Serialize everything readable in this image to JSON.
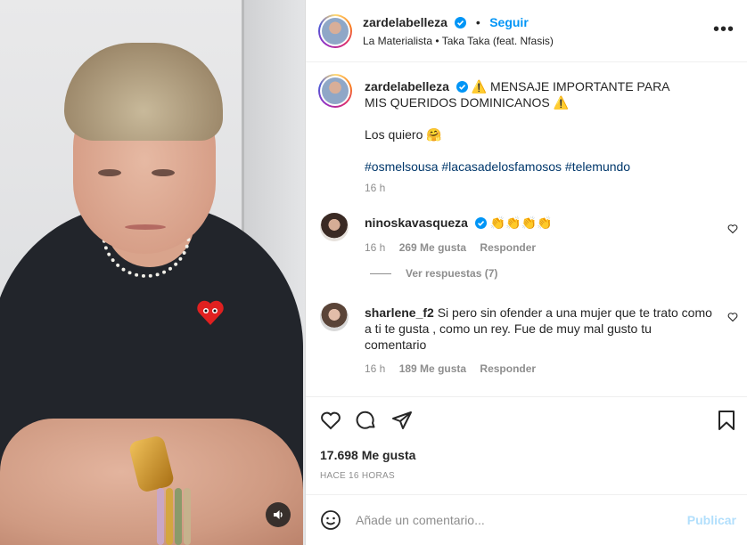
{
  "header": {
    "username": "zardelabelleza",
    "separator": "•",
    "follow_label": "Seguir",
    "song": "La Materialista • Taka Taka (feat. Nfasis)",
    "more_label": "•••"
  },
  "caption": {
    "username": "zardelabelleza",
    "line1": "⚠️ MENSAJE IMPORTANTE PARA MIS QUERIDOS DOMINICANOS ⚠️",
    "line2": "Los quiero 🤗",
    "hashtags": [
      "#osmelsousa",
      "#lacasadelosfamosos",
      "#telemundo"
    ],
    "time": "16 h"
  },
  "comments": [
    {
      "username": "ninoskavasqueza",
      "text": "👏👏👏👏",
      "time": "16 h",
      "likes": "269 Me gusta",
      "reply_label": "Responder"
    },
    {
      "username": "sharlene_f2",
      "text": "Si pero sin ofender a una mujer que te trato como a ti te gusta , como un rey. Fue de muy mal gusto tu comentario",
      "time": "16 h",
      "likes": "189 Me gusta",
      "reply_label": "Responder"
    }
  ],
  "view_replies": "Ver respuestas (7)",
  "post": {
    "likes": "17.698 Me gusta",
    "time_ago": "HACE 16 HORAS"
  },
  "add_comment": {
    "placeholder": "Añade un comentario...",
    "post_label": "Publicar"
  },
  "colors": {
    "accent": "#0095f6",
    "hashtag": "#00376b",
    "muted": "#8e8e8e",
    "post_disabled": "#b2dffc"
  }
}
